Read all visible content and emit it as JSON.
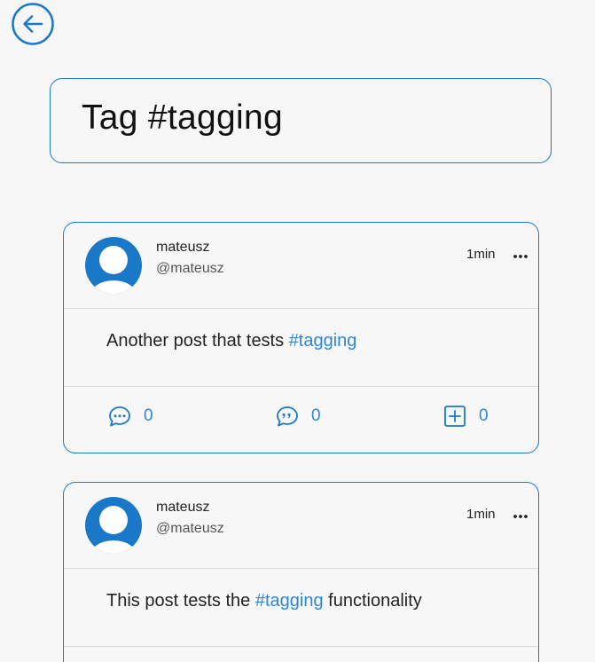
{
  "colors": {
    "accent": "#1a78c9",
    "hashtag": "#2f86d4",
    "background": "#f6f6f6"
  },
  "header": {
    "back_icon": "arrow-left-circle-icon",
    "title": "Tag #tagging"
  },
  "posts": [
    {
      "author_name": "mateusz",
      "author_handle": "@mateusz",
      "time": "1min",
      "text_before": "Another post that tests ",
      "hashtag": "#tagging",
      "text_after": "",
      "comments": "0",
      "quotes": "0",
      "adds": "0"
    },
    {
      "author_name": "mateusz",
      "author_handle": "@mateusz",
      "time": "1min",
      "text_before": "This post tests the ",
      "hashtag": "#tagging",
      "text_after": " functionality"
    }
  ],
  "icons": {
    "avatar": "user-avatar-icon",
    "more": "ellipsis-icon",
    "comment": "comment-bubble-icon",
    "quote": "quote-bubble-icon",
    "add": "plus-square-icon"
  }
}
